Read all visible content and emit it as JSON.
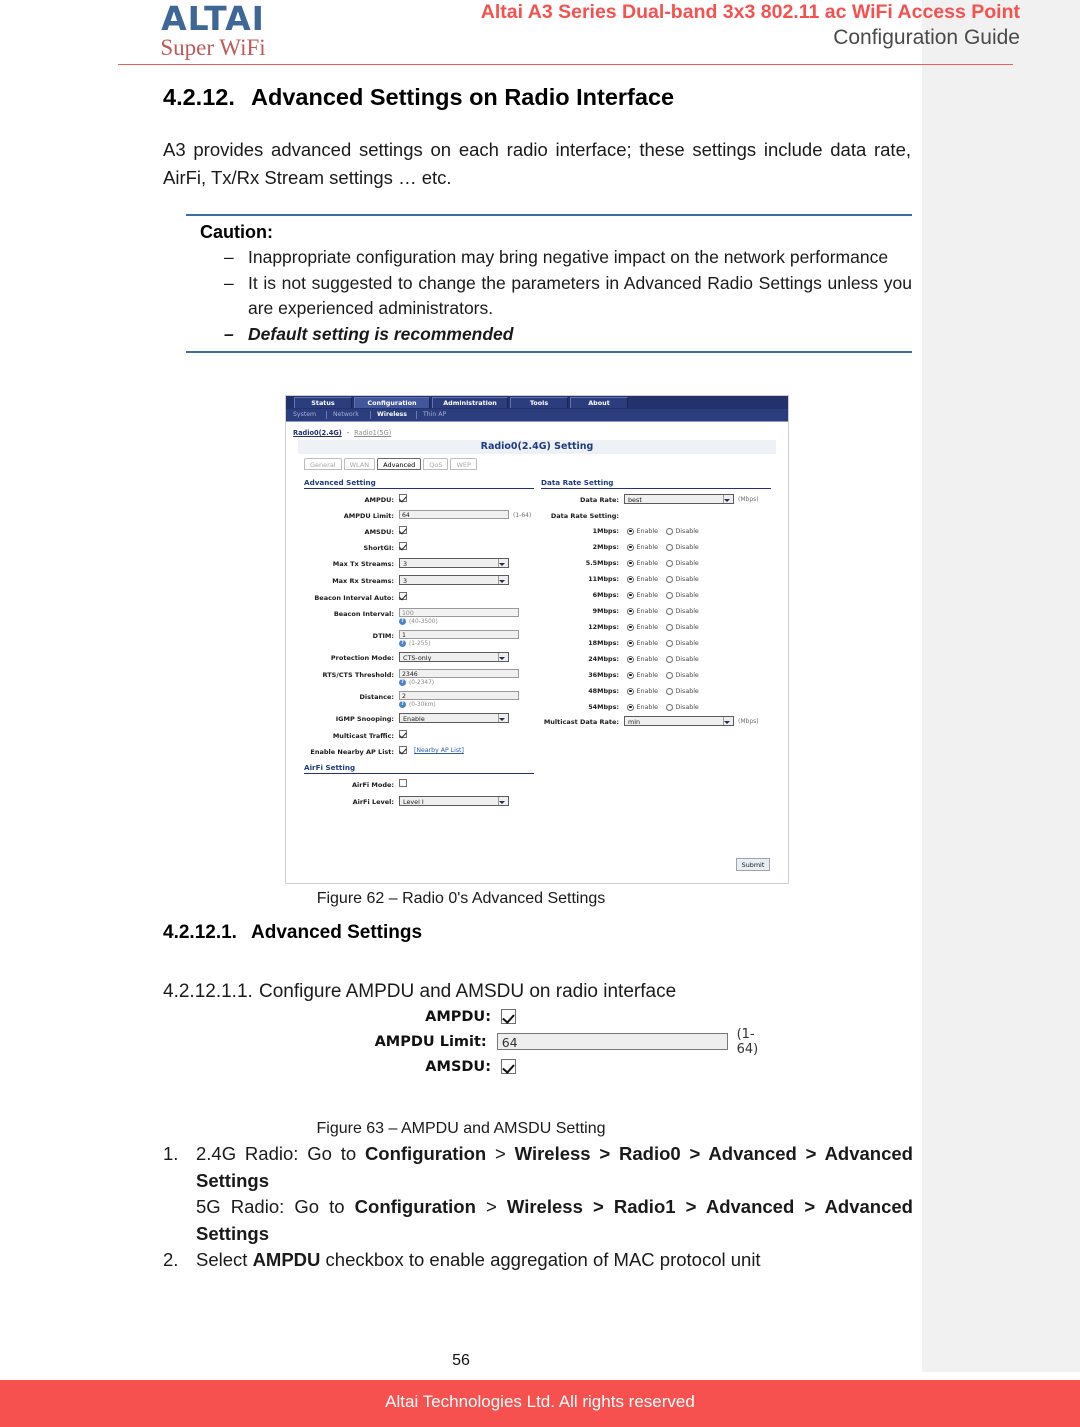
{
  "header": {
    "logo_main": "ALTAI",
    "logo_sub": "Super WiFi",
    "title_line1": "Altai A3 Series Dual-band 3x3 802.11 ac WiFi Access Point",
    "title_line2": "Configuration Guide",
    "accent_red": "#f6514f",
    "logo_blue": "#3f6796"
  },
  "section": {
    "number": "4.2.12.",
    "title": "Advanced Settings on Radio Interface",
    "intro": "A3 provides advanced settings on each radio interface; these settings include data rate, AirFi, Tx/Rx Stream settings … etc."
  },
  "caution": {
    "title": "Caution:",
    "items": [
      "Inappropriate configuration may bring negative impact on the network performance",
      "It is not suggested to change the parameters in Advanced Radio Settings unless you are experienced administrators.",
      "Default setting is recommended"
    ],
    "dash": "–"
  },
  "ui": {
    "top_tabs": [
      {
        "label": "Status",
        "active": false
      },
      {
        "label": "Configuration",
        "active": true
      },
      {
        "label": "Administration",
        "active": false
      },
      {
        "label": "Tools",
        "active": false
      },
      {
        "label": "About",
        "active": false
      }
    ],
    "sub_nav": [
      {
        "label": "System",
        "active": false
      },
      {
        "label": "Network",
        "active": false
      },
      {
        "label": "Wireless",
        "active": true
      },
      {
        "label": "Thin AP",
        "active": false
      }
    ],
    "radio_links": {
      "active": "Radio0(2.4G)",
      "separator": "-",
      "inactive": "Radio1(5G)"
    },
    "page_title": "Radio0(2.4G) Setting",
    "sub_tabs": [
      {
        "label": "General",
        "active": false
      },
      {
        "label": "WLAN",
        "active": false
      },
      {
        "label": "Advanced",
        "active": true
      },
      {
        "label": "QoS",
        "active": false
      },
      {
        "label": "WEP",
        "active": false
      }
    ],
    "advanced_section_title": "Advanced Setting",
    "advanced_fields": {
      "ampdu_label": "AMPDU:",
      "ampdu_checked": true,
      "ampdu_limit_label": "AMPDU Limit:",
      "ampdu_limit_value": "64",
      "ampdu_limit_range": "(1-64)",
      "amsdu_label": "AMSDU:",
      "amsdu_checked": true,
      "shortgi_label": "ShortGI:",
      "shortgi_checked": true,
      "max_tx_label": "Max Tx Streams:",
      "max_tx_value": "3",
      "max_rx_label": "Max Rx Streams:",
      "max_rx_value": "3",
      "beacon_auto_label": "Beacon Interval Auto:",
      "beacon_auto_checked": true,
      "beacon_interval_label": "Beacon Interval:",
      "beacon_interval_value": "100",
      "beacon_interval_range": "(40-3500)",
      "dtim_label": "DTIM:",
      "dtim_value": "1",
      "dtim_range": "(1-255)",
      "protection_label": "Protection Mode:",
      "protection_value": "CTS-only",
      "rtscts_label": "RTS/CTS Threshold:",
      "rtscts_value": "2346",
      "rtscts_range": "(0-2347)",
      "distance_label": "Distance:",
      "distance_value": "2",
      "distance_range": "(0-30km)",
      "igmp_label": "IGMP Snooping:",
      "igmp_value": "Enable",
      "multicast_label": "Multicast Traffic:",
      "multicast_checked": true,
      "nearby_label": "Enable Nearby AP List:",
      "nearby_checked": true,
      "nearby_link": "[Nearby AP List]"
    },
    "airfi_section_title": "AirFi Setting",
    "airfi_fields": {
      "mode_label": "AirFi Mode:",
      "mode_checked": false,
      "level_label": "AirFi Level:",
      "level_value": "Level I"
    },
    "datarate_section_title": "Data Rate Setting",
    "datarate_top": {
      "label": "Data Rate:",
      "value": "best",
      "unit": "(Mbps)"
    },
    "datarate_group_label": "Data Rate Setting:",
    "enable_label": "Enable",
    "disable_label": "Disable",
    "rates": [
      {
        "label": "1Mbps:",
        "state": "Enable"
      },
      {
        "label": "2Mbps:",
        "state": "Enable"
      },
      {
        "label": "5.5Mbps:",
        "state": "Enable"
      },
      {
        "label": "11Mbps:",
        "state": "Enable"
      },
      {
        "label": "6Mbps:",
        "state": "Enable"
      },
      {
        "label": "9Mbps:",
        "state": "Enable"
      },
      {
        "label": "12Mbps:",
        "state": "Enable"
      },
      {
        "label": "18Mbps:",
        "state": "Enable"
      },
      {
        "label": "24Mbps:",
        "state": "Enable"
      },
      {
        "label": "36Mbps:",
        "state": "Enable"
      },
      {
        "label": "48Mbps:",
        "state": "Enable"
      },
      {
        "label": "54Mbps:",
        "state": "Enable"
      }
    ],
    "multicast_rate": {
      "label": "Multicast Data Rate:",
      "value": "min",
      "unit": "(Mbps)"
    },
    "submit_label": "Submit",
    "hint_icon": "?"
  },
  "figure62_caption": "Figure 62 – Radio 0's Advanced Settings",
  "subsection": {
    "number": "4.2.12.1.",
    "title": "Advanced Settings"
  },
  "subsubsection": {
    "number": "4.2.12.1.1.",
    "title": "Configure AMPDU and AMSDU on radio interface"
  },
  "ampdu_figure": {
    "ampdu_label": "AMPDU:",
    "ampdu_limit_label": "AMPDU Limit:",
    "ampdu_limit_value": "64",
    "ampdu_limit_range": "(1-64)",
    "amsdu_label": "AMSDU:"
  },
  "figure63_caption": "Figure 63 – AMPDU and AMSDU Setting",
  "steps": [
    {
      "marker": "1.",
      "html": "2.4G Radio: Go to <b>Configuration</b> &gt; <b>Wireless &gt; Radio0 &gt; Advanced &gt; Advanced Settings</b><br>5G Radio: Go to <b>Configuration</b> &gt; <b>Wireless &gt; Radio1 &gt; Advanced &gt; Advanced Settings</b>"
    },
    {
      "marker": "2.",
      "html": "Select <b>AMPDU</b> checkbox to enable aggregation of MAC protocol unit"
    }
  ],
  "footer": {
    "page_number": "56",
    "copyright": "Altai Technologies Ltd. All rights reserved",
    "bar_color": "#f6514f"
  }
}
